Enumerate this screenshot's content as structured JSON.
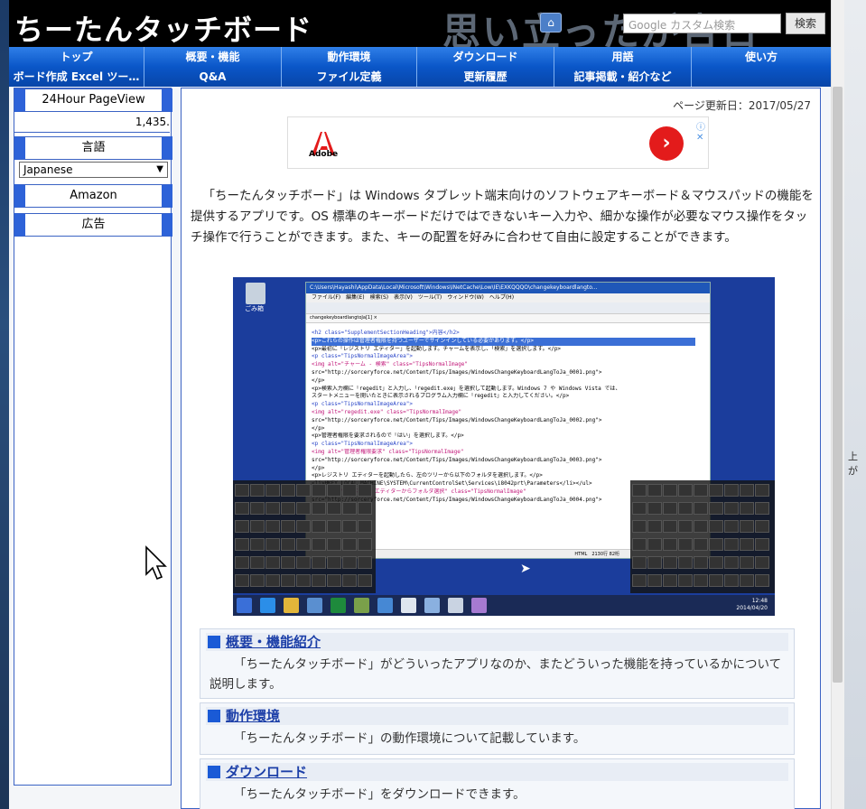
{
  "header": {
    "site_title": "ちーたんタッチボード",
    "banner_text": "思い立ったが吉日",
    "search_placeholder": "Google カスタム検索",
    "search_button": "検索",
    "home_icon": "home-icon"
  },
  "nav": {
    "row1": [
      "トップ",
      "概要・機能",
      "動作環境",
      "ダウンロード",
      "用語",
      "使い方"
    ],
    "row2": [
      "ボード作成 Excel ツー…",
      "Q&A",
      "ファイル定義",
      "更新履歴",
      "記事掲載・紹介など",
      ""
    ]
  },
  "sidebar": {
    "pageview_title": "24Hour PageView",
    "pageview_count": "1,435.",
    "language_title": "言語",
    "language_selected": "Japanese",
    "amazon_title": "Amazon",
    "ads_title": "広告"
  },
  "main": {
    "updated": "ページ更新日：2017/05/27",
    "ad_brand": "Adobe",
    "intro": "「ちーたんタッチボード」は Windows タブレット端末向けのソフトウェアキーボード＆マウスパッドの機能を提供するアプリです。OS 標準のキーボードだけではできないキー入力や、細かな操作が必要なマウス操作をタッチ操作で行うことができます。また、キーの配置を好みに合わせて自由に設定することができます。",
    "sections": [
      {
        "title": "概要・機能紹介",
        "desc": "「ちーたんタッチボード」がどういったアプリなのか、またどういった機能を持っているかについて説明します。"
      },
      {
        "title": "動作環境",
        "desc": "「ちーたんタッチボード」の動作環境について記載しています。"
      },
      {
        "title": "ダウンロード",
        "desc": "「ちーたんタッチボード」をダウンロードできます。"
      }
    ]
  },
  "screenshot": {
    "window_title": "C:\\Users\\Hayashi\\AppData\\Local\\Microsoft\\Windows\\INetCache\\Low\\IE\\EXKQQQO\\changekeyboardlangto...",
    "menu": "ファイル(F)　編集(E)　検索(S)　表示(V)　ツール(T)　ウィンドウ(W)　ヘルプ(H)",
    "tab": "changekeyboardlangtoJa[1] ×",
    "code_lines": [
      "<h2 class=\"SupplementSectionHeading\">内容</h2>",
      "<p>これらの操作は管理者権限を持つユーザーでサインインしている必要があります。</p>",
      "<p>最初に「レジストリ エディター」を起動します。チャームを表示し、「検索」を選択します。</p>",
      "<p class=\"TipsNormalImageArea\">",
      "  <img alt=\"チャーム - 検索\" class=\"TipsNormalImage\"",
      "src=\"http://sorceryforce.net/Content/Tips/Images/WindowsChangeKeyboardLangToJa_0001.png\">",
      "</p>",
      "<p>検索入力欄に「regedit」と入力し、「regedit.exe」を選択して起動します。Windows 7 や Windows Vista では、",
      "スタートメニューを開いたときに表示されるプログラム入力欄に「regedit」と入力してください。</p>",
      "<p class=\"TipsNormalImageArea\">",
      "  <img alt=\"regedit.exe\" class=\"TipsNormalImage\"",
      "src=\"http://sorceryforce.net/Content/Tips/Images/WindowsChangeKeyboardLangToJa_0002.png\">",
      "</p>",
      "<p>管理者権限を要求されるので「はい」を選択します。</p>",
      "<p class=\"TipsNormalImageArea\">",
      "  <img alt=\"管理者権限要求\" class=\"TipsNormalImage\"",
      "src=\"http://sorceryforce.net/Content/Tips/Images/WindowsChangeKeyboardLangToJa_0003.png\">",
      "</p>",
      "<p>レジストリ エディターを起動したら、左のツリーから以下のフォルダを選択します。</p>",
      "<li>HKEY_LOCAL_MACHINE\\SYSTEM\\CurrentControlSet\\Services\\i8042prt\\Parameters</li></ul>",
      "  <img alt=\"レジストリ エディターからフォルダ選択\" class=\"TipsNormalImage\"",
      "src=\"http://sorceryforce.net/Content/Tips/Images/WindowsChangeKeyboardLangToJa_0004.png\">"
    ],
    "status": "HTML　2130行 82桁",
    "clock_time": "12:48",
    "clock_date": "2014/04/20",
    "recycle_label": "ごみ箱"
  },
  "right_edge_text": "上が",
  "colors": {
    "nav_top": "#2f7fe8",
    "nav_bottom": "#0845a8",
    "section_mark": "#1a5ad6",
    "link": "#1c3fa8"
  }
}
